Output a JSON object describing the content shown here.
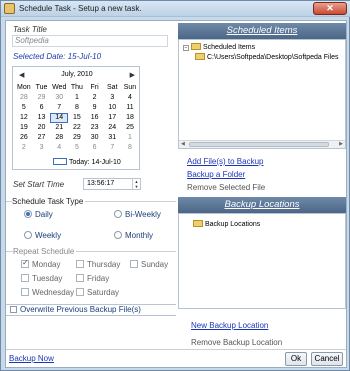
{
  "window": {
    "title": "Schedule Task - Setup a new task."
  },
  "task": {
    "title_label": "Task Title",
    "title_value": "Softpedia",
    "selected_date": "Selected Date: 15-Jul-10"
  },
  "calendar": {
    "month_label": "July, 2010",
    "day_headers": [
      "Mon",
      "Tue",
      "Wed",
      "Thu",
      "Fri",
      "Sat",
      "Sun"
    ],
    "weeks": [
      [
        "28",
        "29",
        "30",
        "1",
        "2",
        "3",
        "4"
      ],
      [
        "5",
        "6",
        "7",
        "8",
        "9",
        "10",
        "11"
      ],
      [
        "12",
        "13",
        "14",
        "15",
        "16",
        "17",
        "18"
      ],
      [
        "19",
        "20",
        "21",
        "22",
        "23",
        "24",
        "25"
      ],
      [
        "26",
        "27",
        "28",
        "29",
        "30",
        "31",
        "1"
      ],
      [
        "2",
        "3",
        "4",
        "5",
        "6",
        "7",
        "8"
      ]
    ],
    "today_label": "Today: 14-Jul-10"
  },
  "start_time": {
    "label": "Set Start Time",
    "value": "13:56:17"
  },
  "schedule_type": {
    "group_title": "Schedule Task Type",
    "options": [
      {
        "label": "Daily",
        "selected": true
      },
      {
        "label": "Bi-Weekly",
        "selected": false
      },
      {
        "label": "Weekly",
        "selected": false
      },
      {
        "label": "Monthly",
        "selected": false
      }
    ]
  },
  "repeat": {
    "label": "Repeat Schedule",
    "days": [
      {
        "label": "Monday",
        "checked": true
      },
      {
        "label": "Thursday",
        "checked": false
      },
      {
        "label": "Sunday",
        "checked": false
      },
      {
        "label": "Tuesday",
        "checked": false
      },
      {
        "label": "Friday",
        "checked": false
      },
      {
        "label": "Wednesday",
        "checked": false
      },
      {
        "label": "Saturday",
        "checked": false
      }
    ]
  },
  "overwrite_label": "Overwrite Previous Backup File(s)",
  "scheduled_items": {
    "header": "Scheduled Items",
    "root": "Scheduled Items",
    "child": "C:\\Users\\Softpeda\\Desktop\\Softpeda Files",
    "add_link": "Add File(s) to Backup",
    "folder_link": "Backup a Folder",
    "remove_label": "Remove Selected File"
  },
  "backup_locations": {
    "header": "Backup Locations",
    "root": "Backup Locations",
    "new_link": "New Backup Location",
    "remove_label": "Remove Backup Location"
  },
  "footer": {
    "backup_now": "Backup Now",
    "ok": "Ok",
    "cancel": "Cancel"
  },
  "colors": {
    "accent": "#3b6fbf",
    "link": "#1b35b8",
    "header_bg": "#4b6687"
  }
}
